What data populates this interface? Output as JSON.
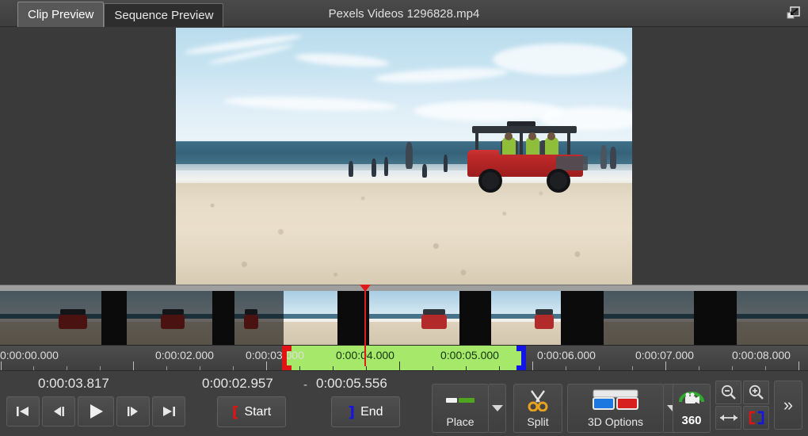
{
  "window": {
    "title": "Pexels Videos 1296828.mp4",
    "restore_icon": "restore-down-icon"
  },
  "tabs": [
    {
      "label": "Clip Preview",
      "active": true
    },
    {
      "label": "Sequence Preview",
      "active": false
    }
  ],
  "preview": {
    "scene_description": "Beach with ocean waves, people wading and a red utility vehicle on the sand"
  },
  "timeline": {
    "ruler_labels": [
      "0:00:00.000",
      "0:00:02.000",
      "0:00:03.000",
      "0:00:04.000",
      "0:00:05.000",
      "0:00:06.000",
      "0:00:07.000",
      "0:00:08.000"
    ],
    "selection_start_label": "0:00:03.000",
    "selection_end_label": "0:00:05.000",
    "in_point": "0:00:02.957",
    "out_point": "0:00:05.556",
    "playhead": "0:00:03.817",
    "selection_color": "#a6e86a",
    "in_marker_color": "#e01414",
    "out_marker_color": "#1414e6",
    "playhead_color": "#e01a1a"
  },
  "transport": {
    "position_timecode": "0:00:03.817",
    "in_timecode": "0:00:02.957",
    "range_dash": "-",
    "out_timecode": "0:00:05.556",
    "buttons": [
      {
        "name": "go-to-start-button",
        "icon": "skip-back-icon"
      },
      {
        "name": "step-back-button",
        "icon": "step-back-icon"
      },
      {
        "name": "play-button",
        "icon": "play-icon"
      },
      {
        "name": "step-forward-button",
        "icon": "step-forward-icon"
      },
      {
        "name": "go-to-end-button",
        "icon": "skip-forward-icon"
      }
    ],
    "mark_start_label": "Start",
    "mark_end_label": "End"
  },
  "toolbar": {
    "place_label": "Place",
    "split_label": "Split",
    "three_d_label": "3D Options",
    "threesixty_label": "360",
    "zoom_out_icon": "zoom-out-icon",
    "zoom_in_icon": "zoom-in-icon",
    "fit_width_icon": "fit-width-icon",
    "fit_selection_icon": "fit-selection-icon",
    "more_label": "»"
  }
}
